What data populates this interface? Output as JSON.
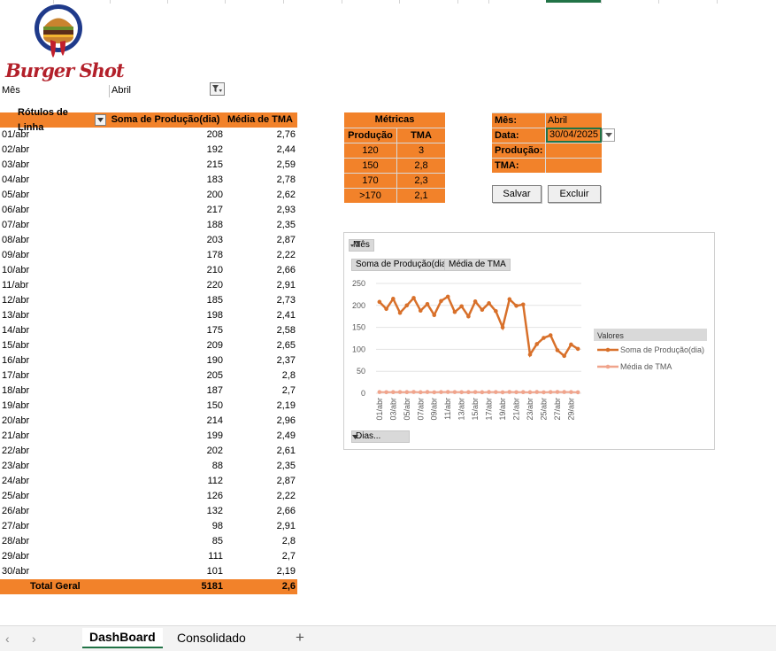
{
  "brand": {
    "logo_text": "Burger Shot"
  },
  "filter": {
    "label": "Mês",
    "value": "Abril"
  },
  "pivot": {
    "headers": [
      "Rótulos de Linha",
      "Soma de Produção(dia)",
      "Média de TMA"
    ],
    "rows": [
      [
        "01/abr",
        "208",
        "2,76"
      ],
      [
        "02/abr",
        "192",
        "2,44"
      ],
      [
        "03/abr",
        "215",
        "2,59"
      ],
      [
        "04/abr",
        "183",
        "2,78"
      ],
      [
        "05/abr",
        "200",
        "2,62"
      ],
      [
        "06/abr",
        "217",
        "2,93"
      ],
      [
        "07/abr",
        "188",
        "2,35"
      ],
      [
        "08/abr",
        "203",
        "2,87"
      ],
      [
        "09/abr",
        "178",
        "2,22"
      ],
      [
        "10/abr",
        "210",
        "2,66"
      ],
      [
        "11/abr",
        "220",
        "2,91"
      ],
      [
        "12/abr",
        "185",
        "2,73"
      ],
      [
        "13/abr",
        "198",
        "2,41"
      ],
      [
        "14/abr",
        "175",
        "2,58"
      ],
      [
        "15/abr",
        "209",
        "2,65"
      ],
      [
        "16/abr",
        "190",
        "2,37"
      ],
      [
        "17/abr",
        "205",
        "2,8"
      ],
      [
        "18/abr",
        "187",
        "2,7"
      ],
      [
        "19/abr",
        "150",
        "2,19"
      ],
      [
        "20/abr",
        "214",
        "2,96"
      ],
      [
        "21/abr",
        "199",
        "2,49"
      ],
      [
        "22/abr",
        "202",
        "2,61"
      ],
      [
        "23/abr",
        "88",
        "2,35"
      ],
      [
        "24/abr",
        "112",
        "2,87"
      ],
      [
        "25/abr",
        "126",
        "2,22"
      ],
      [
        "26/abr",
        "132",
        "2,66"
      ],
      [
        "27/abr",
        "98",
        "2,91"
      ],
      [
        "28/abr",
        "85",
        "2,8"
      ],
      [
        "29/abr",
        "111",
        "2,7"
      ],
      [
        "30/abr",
        "101",
        "2,19"
      ]
    ],
    "total": [
      "Total Geral",
      "5181",
      "2,6"
    ]
  },
  "metrics": {
    "title": "Métricas",
    "headers": [
      "Produção",
      "TMA"
    ],
    "rows": [
      [
        "120",
        "3"
      ],
      [
        "150",
        "2,8"
      ],
      [
        "170",
        "2,3"
      ],
      [
        ">170",
        "2,1"
      ]
    ]
  },
  "form": {
    "fields": [
      {
        "label": "Mês:",
        "value": "Abril"
      },
      {
        "label": "Data:",
        "value": "30/04/2025"
      },
      {
        "label": "Produção:",
        "value": ""
      },
      {
        "label": "TMA:",
        "value": ""
      }
    ],
    "save_label": "Salvar",
    "delete_label": "Excluir"
  },
  "chart_buttons": {
    "filter": "Mês",
    "value1": "Soma de Produção(dia)",
    "value2": "Média de TMA",
    "axis": "Dias..."
  },
  "chart_data": {
    "type": "line",
    "legend_title": "Valores",
    "legend_position": "right",
    "ylim": [
      0,
      250
    ],
    "yticks": [
      0,
      50,
      100,
      150,
      200,
      250
    ],
    "x": [
      "01/abr",
      "02/abr",
      "03/abr",
      "04/abr",
      "05/abr",
      "06/abr",
      "07/abr",
      "08/abr",
      "09/abr",
      "10/abr",
      "11/abr",
      "12/abr",
      "13/abr",
      "14/abr",
      "15/abr",
      "16/abr",
      "17/abr",
      "18/abr",
      "19/abr",
      "20/abr",
      "21/abr",
      "22/abr",
      "23/abr",
      "24/abr",
      "25/abr",
      "26/abr",
      "27/abr",
      "28/abr",
      "29/abr",
      "30/abr"
    ],
    "series": [
      {
        "name": "Soma de Produção(dia)",
        "color": "#d8702a",
        "values": [
          208,
          192,
          215,
          183,
          200,
          217,
          188,
          203,
          178,
          210,
          220,
          185,
          198,
          175,
          209,
          190,
          205,
          187,
          150,
          214,
          199,
          202,
          88,
          112,
          126,
          132,
          98,
          85,
          111,
          101
        ]
      },
      {
        "name": "Média de TMA",
        "color": "#f0a48c",
        "values": [
          2.76,
          2.44,
          2.59,
          2.78,
          2.62,
          2.93,
          2.35,
          2.87,
          2.22,
          2.66,
          2.91,
          2.73,
          2.41,
          2.58,
          2.65,
          2.37,
          2.8,
          2.7,
          2.19,
          2.96,
          2.49,
          2.61,
          2.35,
          2.87,
          2.22,
          2.66,
          2.91,
          2.8,
          2.7,
          2.19
        ]
      }
    ]
  },
  "sheet_tabs": {
    "active": "DashBoard",
    "other": "Consolidado",
    "add": "+",
    "prev": "‹",
    "next": "›"
  },
  "colors": {
    "accent": "#f2822a",
    "excel_green": "#217346"
  }
}
